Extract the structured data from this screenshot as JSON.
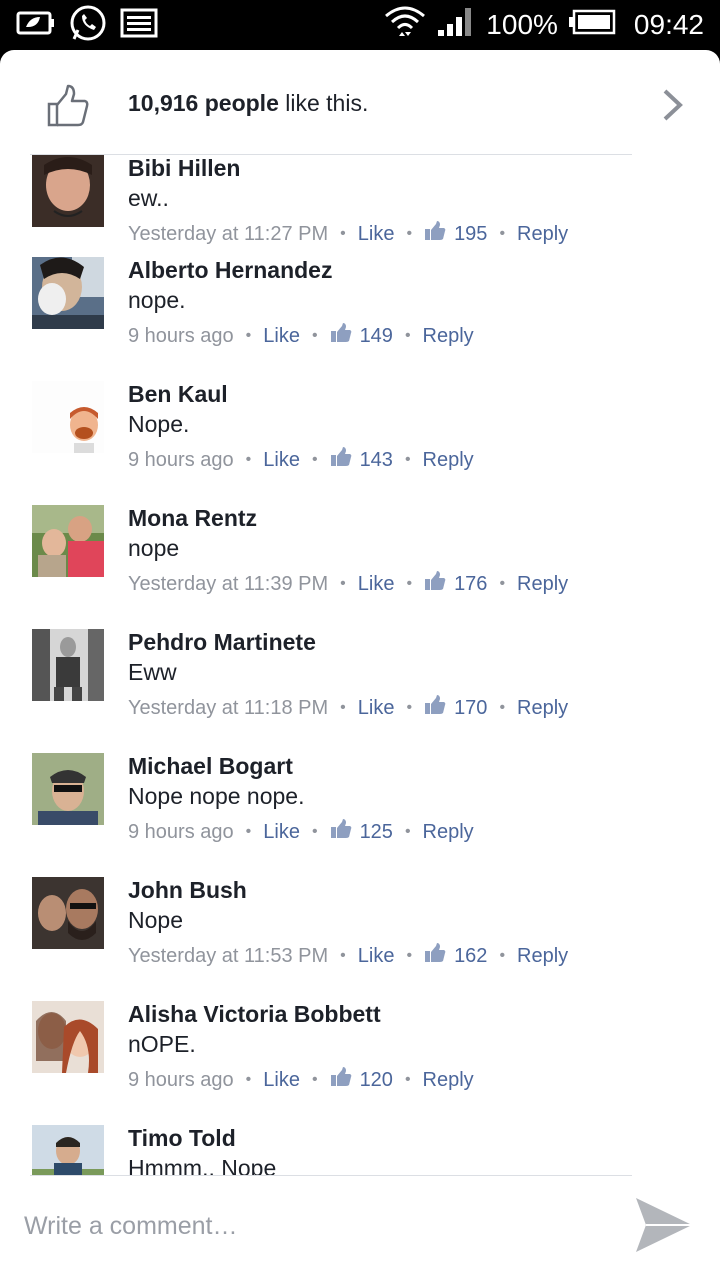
{
  "status_bar": {
    "battery": "100%",
    "time": "09:42",
    "icons": [
      "battery-saver-icon",
      "whatsapp-icon",
      "image-icon",
      "wifi-icon",
      "signal-icon",
      "battery-icon"
    ]
  },
  "likes": {
    "count": "10,916 people",
    "suffix": " like this."
  },
  "comments": [
    {
      "name": "Bibi Hillen",
      "text": "ew..",
      "time": "Yesterday at 11:27 PM",
      "like_label": "Like",
      "likes": "195",
      "reply_label": "Reply"
    },
    {
      "name": "Alberto Hernandez",
      "text": "nope.",
      "time": "9 hours ago",
      "like_label": "Like",
      "likes": "149",
      "reply_label": "Reply"
    },
    {
      "name": "Ben Kaul",
      "text": "Nope.",
      "time": "9 hours ago",
      "like_label": "Like",
      "likes": "143",
      "reply_label": "Reply"
    },
    {
      "name": "Mona Rentz",
      "text": "nope",
      "time": "Yesterday at 11:39 PM",
      "like_label": "Like",
      "likes": "176",
      "reply_label": "Reply"
    },
    {
      "name": "Pehdro Martinete",
      "text": "Eww",
      "time": "Yesterday at 11:18 PM",
      "like_label": "Like",
      "likes": "170",
      "reply_label": "Reply"
    },
    {
      "name": "Michael Bogart",
      "text": "Nope nope nope.",
      "time": "9 hours ago",
      "like_label": "Like",
      "likes": "125",
      "reply_label": "Reply"
    },
    {
      "name": "John Bush",
      "text": "Nope",
      "time": "Yesterday at 11:53 PM",
      "like_label": "Like",
      "likes": "162",
      "reply_label": "Reply"
    },
    {
      "name": "Alisha Victoria Bobbett",
      "text": "nOPE.",
      "time": "9 hours ago",
      "like_label": "Like",
      "likes": "120",
      "reply_label": "Reply"
    },
    {
      "name": "Timo Told",
      "text": "Hmmm.. Nope",
      "time": "",
      "like_label": "",
      "likes": "",
      "reply_label": ""
    }
  ],
  "composer": {
    "placeholder": "Write a comment…"
  },
  "colors": {
    "link": "#4b669b",
    "meta": "#90949c",
    "text": "#1d2129"
  }
}
